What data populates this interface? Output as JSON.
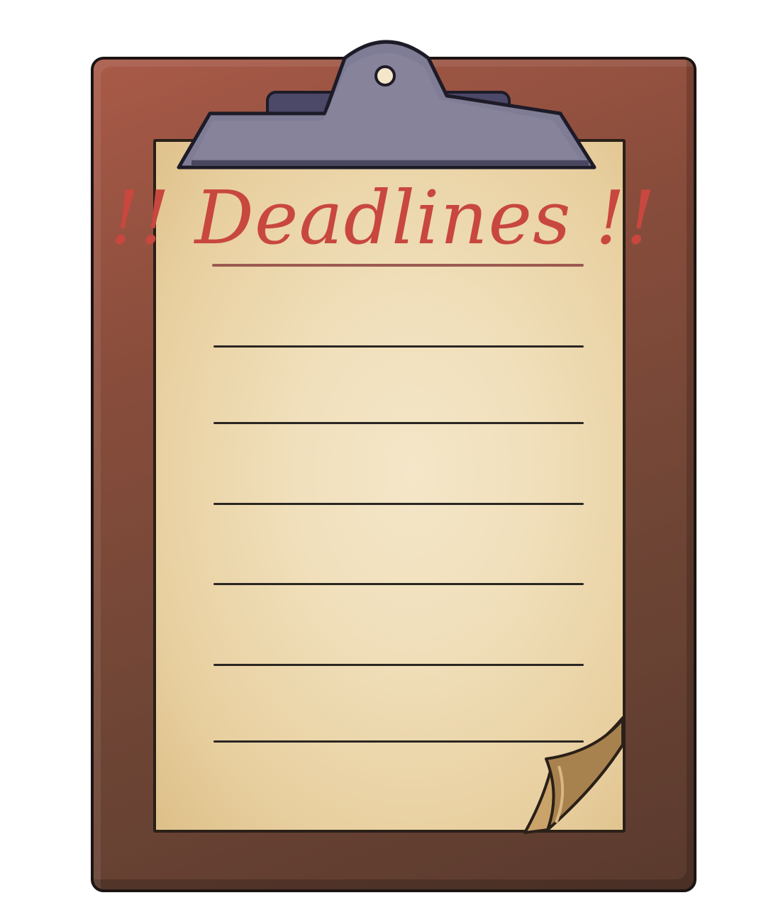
{
  "title": "!! Deadlines !!",
  "colors": {
    "board": "#8a4d3c",
    "paper": "#f0dfba",
    "clip": "#7c7a92",
    "title": "#c8473f",
    "lines": "#2a2622"
  },
  "icons": [
    "clipboard-clip-icon",
    "page-curl-icon"
  ]
}
